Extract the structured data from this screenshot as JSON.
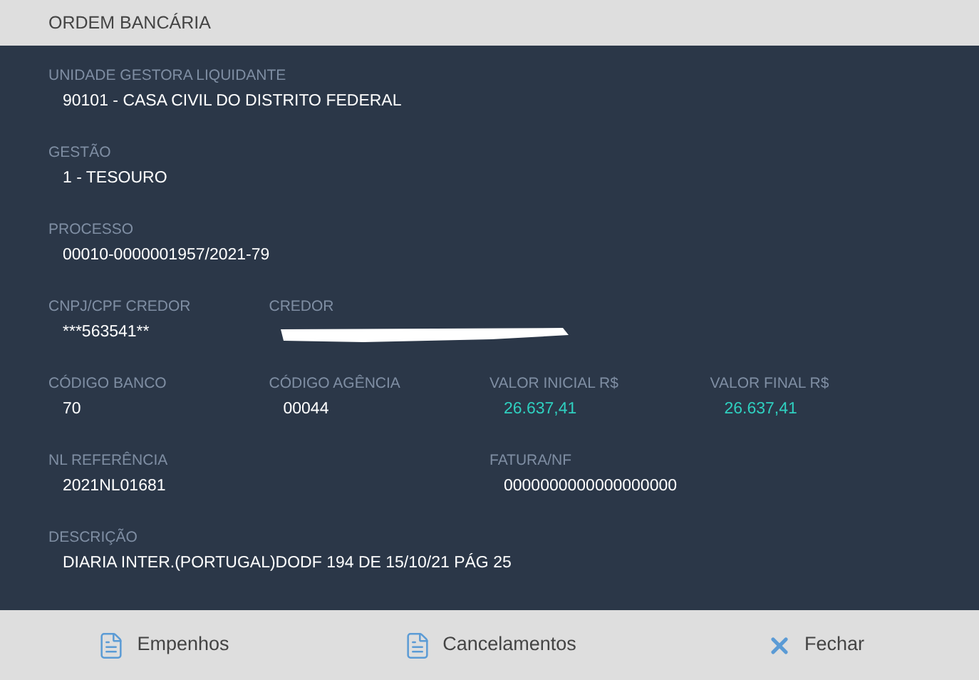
{
  "window": {
    "title": "ORDEM BANCÁRIA"
  },
  "rows": [
    [
      {
        "label": "UNIDADE GESTORA LIQUIDANTE",
        "value": "90101 - CASA CIVIL DO DISTRITO FEDERAL",
        "kind": "text"
      }
    ],
    [
      {
        "label": "GESTÃO",
        "value": "1 - TESOURO",
        "kind": "text"
      }
    ],
    [
      {
        "label": "PROCESSO",
        "value": "00010-0000001957/2021-79",
        "kind": "text"
      }
    ],
    [
      {
        "label": "CNPJ/CPF CREDOR",
        "value": "***563541**",
        "kind": "text"
      },
      {
        "label": "CREDOR",
        "kind": "redacted"
      }
    ],
    [
      {
        "label": "CÓDIGO BANCO",
        "value": "70",
        "kind": "text"
      },
      {
        "label": "CÓDIGO AGÊNCIA",
        "value": "00044",
        "kind": "text"
      },
      {
        "label": "VALOR INICIAL R$",
        "value": "26.637,41",
        "kind": "money"
      },
      {
        "label": "VALOR FINAL R$",
        "value": "26.637,41",
        "kind": "money"
      }
    ],
    [
      {
        "label": "NL REFERÊNCIA",
        "value": "2021NL01681",
        "kind": "text"
      },
      {
        "label": "FATURA/NF",
        "value": "0000000000000000000",
        "kind": "text"
      }
    ],
    [
      {
        "label": "DESCRIÇÃO",
        "value": "DIARIA INTER.(PORTUGAL)DODF 194 DE 15/10/21 PÁG 25",
        "kind": "text"
      }
    ]
  ],
  "buttons": [
    {
      "label": "Empenhos",
      "kind": "document"
    },
    {
      "label": "Cancelamentos",
      "kind": "document"
    },
    {
      "label": "Fechar",
      "kind": "close"
    }
  ]
}
